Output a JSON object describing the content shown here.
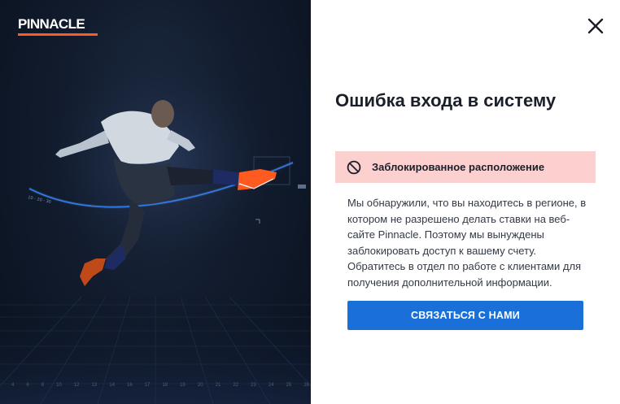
{
  "brand": {
    "name": "PINNACLE",
    "accent_color": "#ff5a1f"
  },
  "hero": {
    "scale_labels": [
      "4",
      "6",
      "8",
      "10",
      "12",
      "13",
      "14",
      "16",
      "17",
      "18",
      "19",
      "20",
      "21",
      "22",
      "23",
      "24",
      "25",
      "26"
    ],
    "arc_label": "10 - 20 - 30"
  },
  "dialog": {
    "close_icon": "close-icon",
    "title": "Ошибка входа в систему",
    "alert": {
      "icon": "blocked-icon",
      "text": "Заблокированное расположение",
      "background": "#fdd0d0"
    },
    "message": "Мы обнаружили, что вы находитесь в регионе, в котором не разрешено делать ставки на веб-сайте Pinnacle. Поэтому мы вынуждены заблокировать доступ к вашему счету. Обратитесь в отдел по работе с клиентами для получения дополнительной информации.",
    "contact_button": "СВЯЗАТЬСЯ С НАМИ",
    "button_color": "#1b6fd9"
  }
}
